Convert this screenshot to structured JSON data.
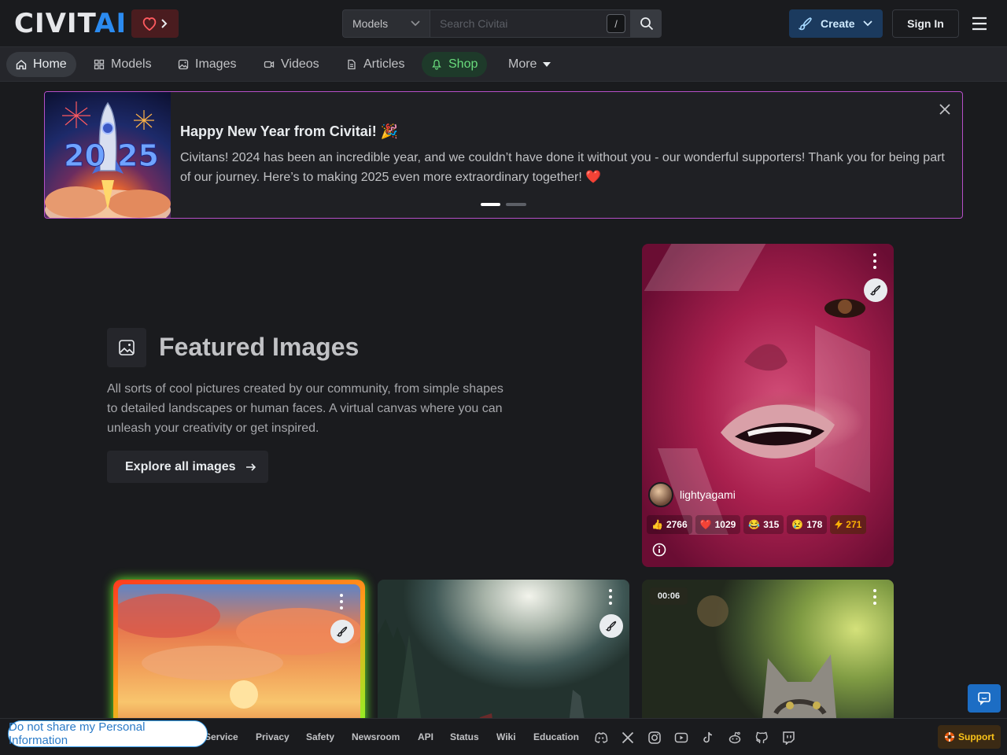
{
  "header": {
    "logo_civ": "CIVIT",
    "logo_ai": "AI",
    "search_scope": "Models",
    "search_placeholder": "Search Civitai",
    "search_shortcut": "/",
    "create_label": "Create",
    "signin_label": "Sign In"
  },
  "nav": {
    "items": [
      {
        "label": "Home",
        "icon": "home-icon",
        "active": true
      },
      {
        "label": "Models",
        "icon": "grid-icon"
      },
      {
        "label": "Images",
        "icon": "image-icon"
      },
      {
        "label": "Videos",
        "icon": "video-icon"
      },
      {
        "label": "Articles",
        "icon": "file-icon"
      },
      {
        "label": "Shop",
        "icon": "bell-icon"
      },
      {
        "label": "More",
        "icon": "caret-down-icon"
      }
    ]
  },
  "banner": {
    "title": "Happy New Year from Civitai! 🎉",
    "text": "Civitans! 2024 has been an incredible year, and we couldn’t have done it without you - our wonderful supporters! Thank you for being part of our journey. Here’s to making 2025 even more extraordinary together! ❤️",
    "image_text_left": "20",
    "image_text_right": "25",
    "slide_count": 2,
    "active_slide": 1
  },
  "featured": {
    "title": "Featured Images",
    "description": "All sorts of cool pictures created by our community, from simple shapes to detailed landscapes or human faces. A virtual canvas where you can unleash your creativity or get inspired.",
    "explore_label": "Explore all images"
  },
  "cards": {
    "main": {
      "username": "lightyagami",
      "reactions": [
        {
          "icon": "👍",
          "count": "2766"
        },
        {
          "icon": "❤️",
          "count": "1029"
        },
        {
          "icon": "😂",
          "count": "315"
        },
        {
          "icon": "😢",
          "count": "178"
        }
      ],
      "buzz": "271"
    },
    "video_time": "00:06"
  },
  "footer": {
    "privacy_pill": "Do not share my Personal Information",
    "links": [
      "Service",
      "Privacy",
      "Safety",
      "Newsroom",
      "API",
      "Status",
      "Wiki",
      "Education"
    ],
    "social_icons": [
      "discord-icon",
      "x-icon",
      "instagram-icon",
      "youtube-icon",
      "tiktok-icon",
      "reddit-icon",
      "github-icon",
      "twitch-icon"
    ],
    "support_label": "Support"
  }
}
